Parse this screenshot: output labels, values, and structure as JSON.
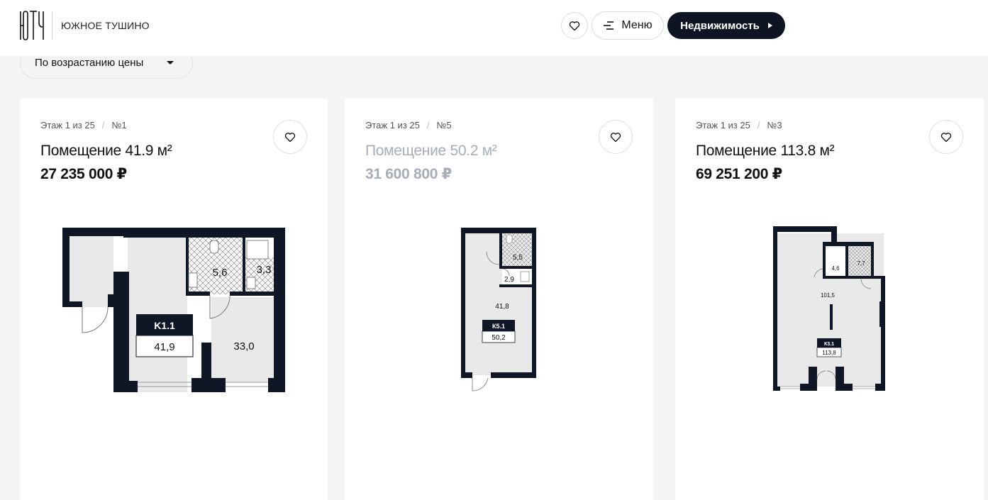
{
  "header": {
    "brand_name": "ЮЖНОЕ ТУШИНО",
    "menu_label": "Меню",
    "estate_label": "Недвижимость"
  },
  "sort": {
    "label": "По возрастанию цены"
  },
  "cards": [
    {
      "floor": "Этаж 1 из 25",
      "number": "№1",
      "title": "Помещение 41.9 м²",
      "price": "27 235 000 ₽",
      "plan": {
        "code": "K1.1",
        "total": "41,9",
        "rooms": [
          "5,6",
          "3,3",
          "33,0"
        ]
      }
    },
    {
      "floor": "Этаж 1 из 25",
      "number": "№5",
      "title": "Помещение 50.2 м²",
      "price": "31 600 800 ₽",
      "plan": {
        "code": "К5.1",
        "total": "50,2",
        "rooms": [
          "5,5",
          "2,9",
          "41,8"
        ]
      }
    },
    {
      "floor": "Этаж 1 из 25",
      "number": "№3",
      "title": "Помещение 113.8 м²",
      "price": "69 251 200 ₽",
      "plan": {
        "code": "К3.1",
        "total": "113,8",
        "rooms": [
          "4,6",
          "7,7",
          "101,5"
        ]
      }
    }
  ],
  "colors": {
    "dark": "#0e1424",
    "wall": "#0f1626",
    "floor": "#e9e9e9",
    "muted": "#a7adb8"
  },
  "icons": [
    "brand-logo",
    "heart-icon",
    "menu-lines-icon",
    "triangle-right-icon",
    "caret-down-icon"
  ]
}
